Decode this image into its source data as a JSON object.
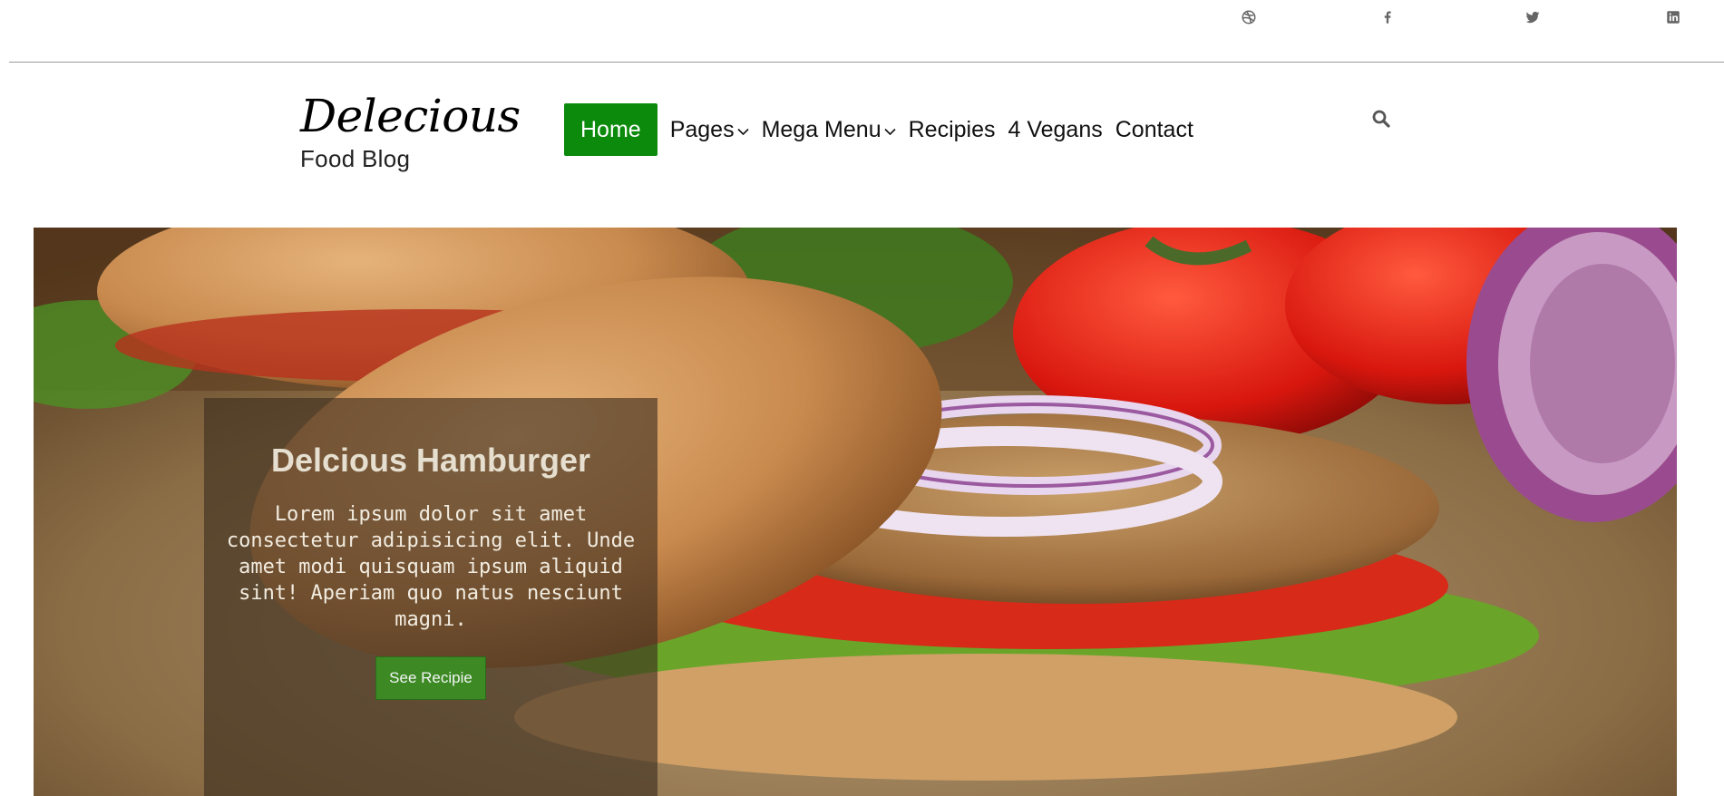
{
  "social": {
    "icons": [
      "dribbble-icon",
      "facebook-icon",
      "twitter-icon",
      "linkedin-icon"
    ]
  },
  "brand": {
    "title": "Delecious",
    "subtitle": "Food Blog"
  },
  "nav": {
    "items": [
      "Home",
      "Pages",
      "Mega Menu",
      "Recipies",
      "4 Vegans",
      "Contact"
    ],
    "active": "Home",
    "active_color": "#0b8a0b"
  },
  "search": {
    "icon": "search-icon"
  },
  "hero": {
    "title": "Delcious Hamburger",
    "text": "Lorem ipsum dolor sit amet consectetur adipisicing elit. Unde amet modi quisquam ipsum aliquid sint! Aperiam quo natus nesciunt magni.",
    "button_label": "See Recipie",
    "button_color": "#3d8a25"
  }
}
